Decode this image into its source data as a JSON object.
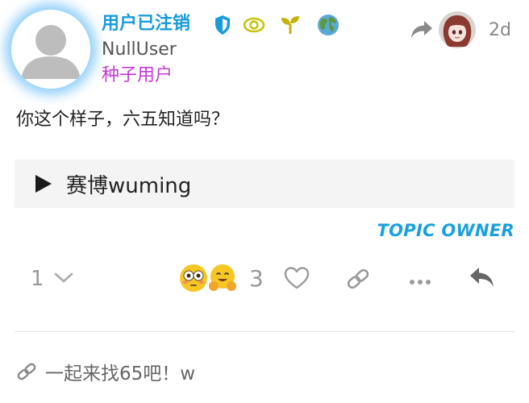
{
  "author": {
    "display_name": "用户已注销",
    "username": "NullUser",
    "title": "种子用户"
  },
  "post": {
    "date": "2d",
    "text": "你这个样子，六五知道吗？",
    "details_summary": "赛博wuming",
    "owner_label": "TOPIC OWNER"
  },
  "actions": {
    "reply_count": "1",
    "like_count": "3"
  },
  "linked_topic": {
    "title": "一起来找65吧！w"
  },
  "icons": [
    "shield-icon",
    "eye-icon",
    "sprout-icon",
    "globe-icon",
    "reply-arrow-icon",
    "chevron-down-icon",
    "heart-icon",
    "link-icon",
    "more-icon",
    "share-icon"
  ],
  "colors": {
    "name": "#1a9bdc",
    "user_title": "#c23bd4",
    "owner_label": "#1aa0dc",
    "avatar_glow": "#3aaaf5"
  }
}
